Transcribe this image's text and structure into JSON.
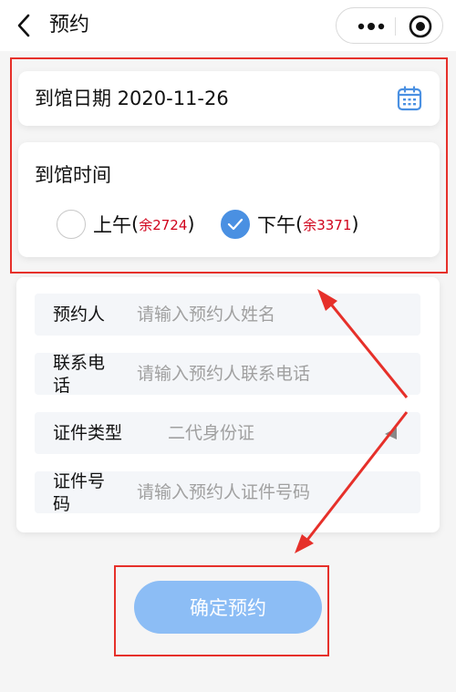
{
  "nav": {
    "title": "预约",
    "back_icon": "chevron-left-icon",
    "more_icon": "more-dots-icon",
    "close_icon": "target-circle-icon"
  },
  "date_card": {
    "text": "到馆日期 2020-11-26",
    "icon": "calendar-icon",
    "icon_color": "#4a90e2"
  },
  "time_card": {
    "title": "到馆时间",
    "options": [
      {
        "label": "上午",
        "open": "(",
        "remain": "余2724",
        "close": ")",
        "selected": false
      },
      {
        "label": "下午",
        "open": "(",
        "remain": "余3371",
        "close": ")",
        "selected": true
      }
    ]
  },
  "form": {
    "rows": [
      {
        "label": "预约人",
        "value": "请输入预约人姓名"
      },
      {
        "label": "联系电话",
        "value": "请输入预约人联系电话"
      },
      {
        "label": "证件类型",
        "value": "二代身份证"
      },
      {
        "label": "证件号码",
        "value": "请输入预约人证件号码"
      }
    ]
  },
  "confirm_button": {
    "label": "确定预约"
  },
  "colors": {
    "accent": "#4a90e2",
    "button": "#8cbdf5",
    "annotation_red": "#e6302a",
    "remain_red": "#d0021b"
  }
}
